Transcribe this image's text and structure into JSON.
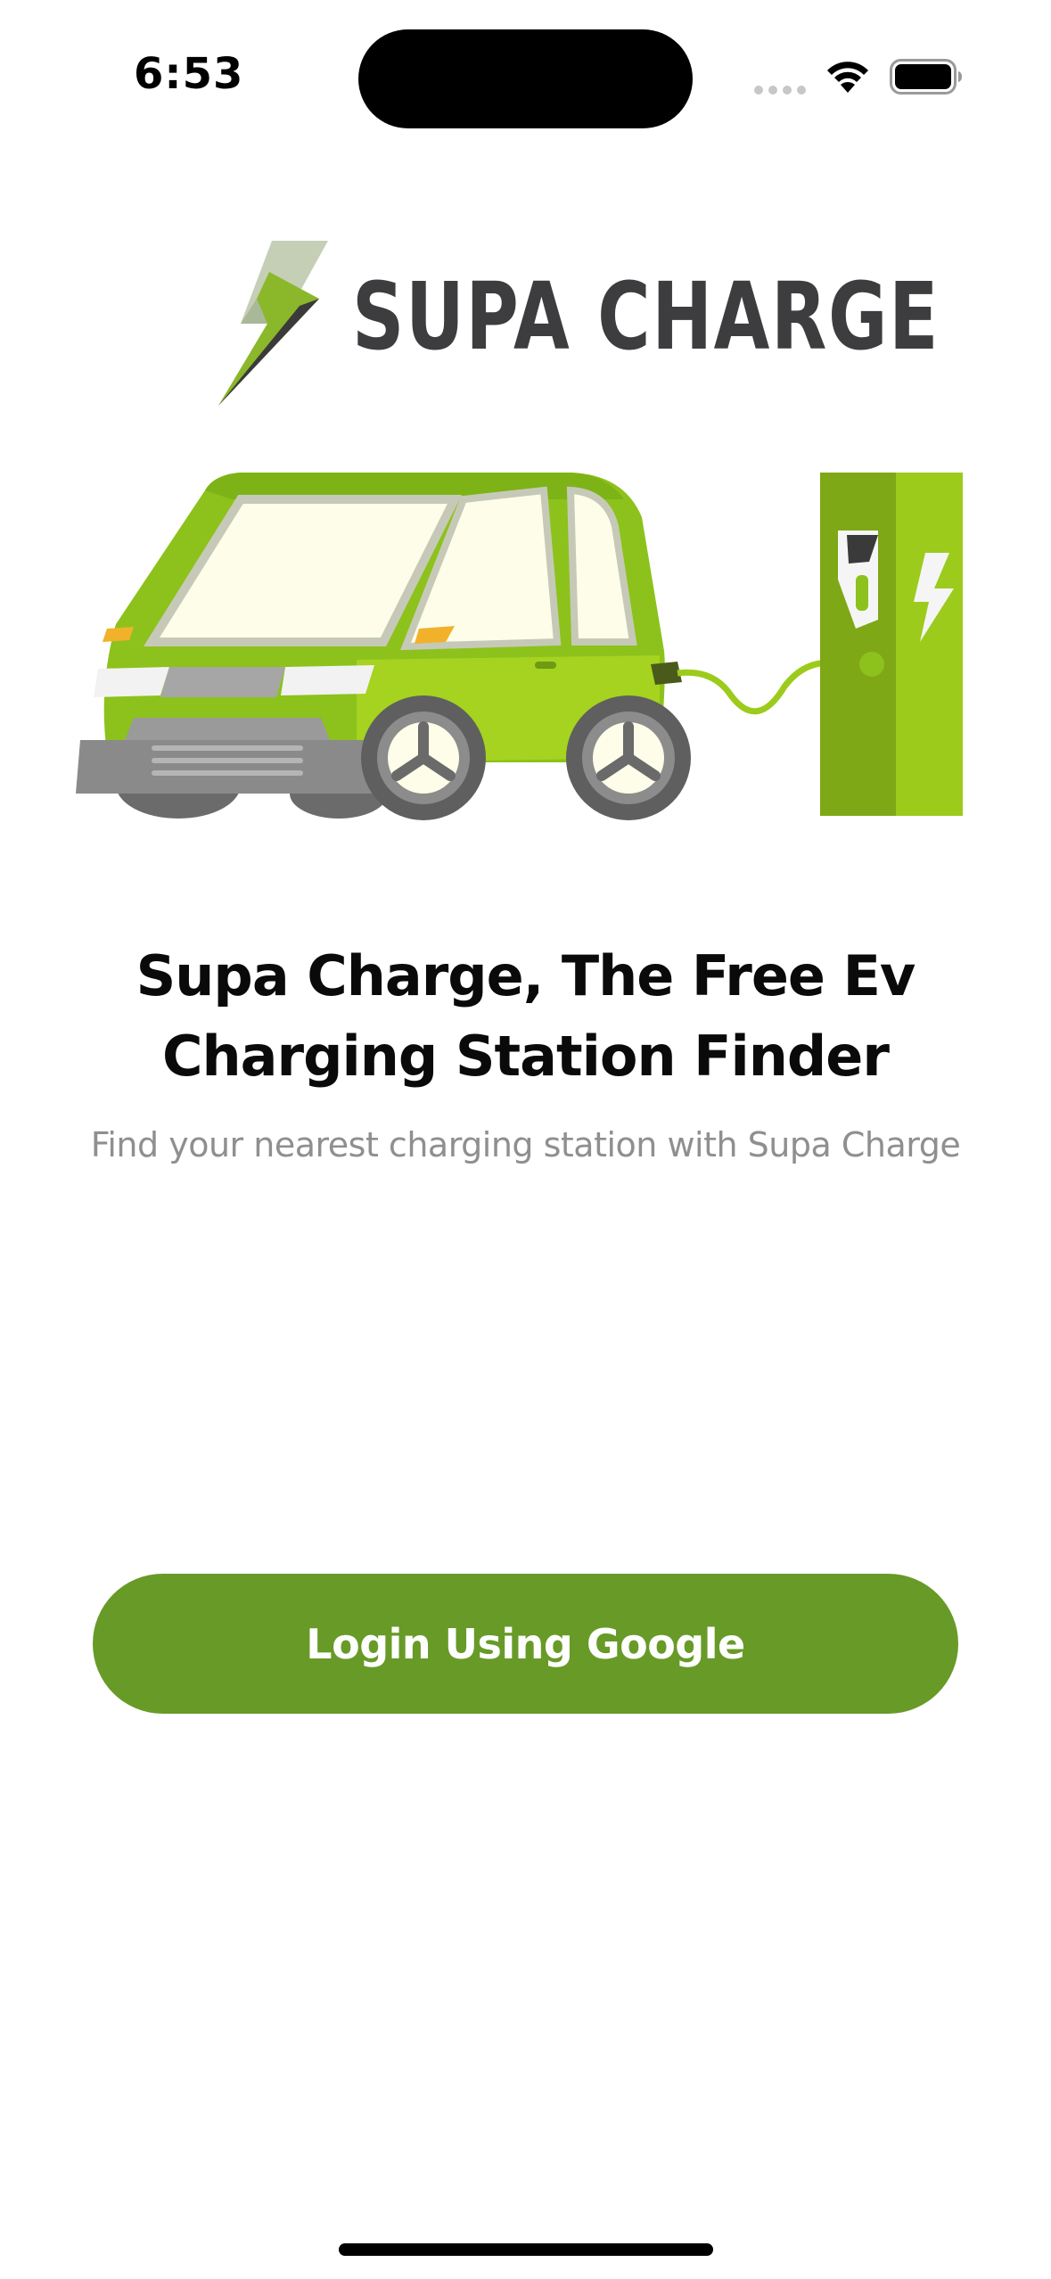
{
  "status_bar": {
    "time": "6:53",
    "icons": [
      "cellular-dots-icon",
      "wifi-icon",
      "battery-icon"
    ]
  },
  "logo": {
    "text": "SUPA CHARGE",
    "icon": "lightning-bolt-icon",
    "colors": {
      "bolt_light": "#b9c8a6",
      "bolt_green": "#8ab82a",
      "bolt_dark": "#3a3a3a",
      "text": "#3d3d3f"
    }
  },
  "illustration": {
    "subject": "ev-car-charging-illustration",
    "colors": {
      "car_body": "#8cc21b",
      "car_light": "#a8d61f",
      "window": "#fdfde9",
      "bumper": "#8a8a8a",
      "charger": "#9ccb1c"
    }
  },
  "headline": {
    "line1": "Supa Charge, The Free Ev",
    "line2": "Charging Station Finder"
  },
  "subtitle": "Find your nearest charging station with Supa Charge",
  "login_button": {
    "label": "Login Using Google",
    "color": "#689a28"
  }
}
